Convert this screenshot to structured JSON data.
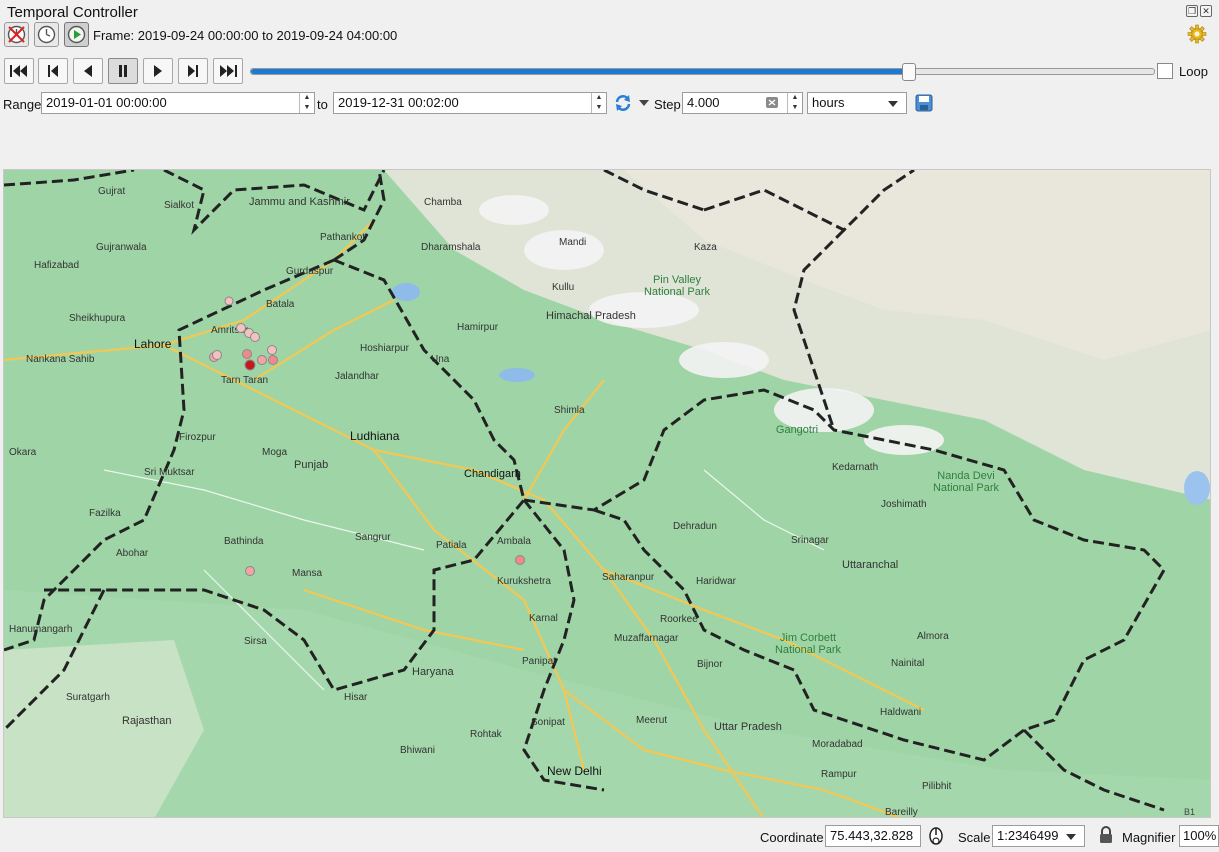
{
  "window": {
    "title": "Temporal Controller",
    "restore_symbol": "❐",
    "close_symbol": "✕"
  },
  "toolbar": {
    "mode_buttons": [
      {
        "name": "disable-temporal-navigation",
        "icon": "disabled-clock-icon"
      },
      {
        "name": "fixed-range-mode",
        "icon": "clock-icon"
      },
      {
        "name": "animated-mode",
        "icon": "play-circle-icon"
      }
    ],
    "frame_label": "Frame: 2019-09-24 00:00:00 to 2019-09-24 04:00:00",
    "settings_icon": "gear-icon"
  },
  "playback": {
    "buttons": [
      "rewind-to-start",
      "step-back",
      "play-backward",
      "pause",
      "play-forward",
      "step-forward",
      "fast-forward-to-end"
    ],
    "progress_fraction": 0.728,
    "loop_label": "Loop",
    "loop_checked": false,
    "accent": "#1f78d1"
  },
  "range": {
    "label": "Range",
    "start": "2019-01-01 00:00:00",
    "to_label": "to",
    "end": "2019-12-31 00:02:00",
    "step_label": "Step",
    "step_value": "4.000",
    "unit": "hours"
  },
  "map": {
    "regions": [
      "Jammu and Kashmir",
      "Himachal Pradesh",
      "Punjab",
      "Haryana",
      "Uttaranchal",
      "Uttar Pradesh",
      "Rajasthan"
    ],
    "cities": [
      "Gujrat",
      "Sialkot",
      "Gujranwala",
      "Hafizabad",
      "Sheikhupura",
      "Lahore",
      "Nankana Sahib",
      "Okara",
      "Pathankot",
      "Gurdaspur",
      "Batala",
      "Amritsar",
      "Tarn Taran Sahib",
      "Jalandhar",
      "Hoshiarpur",
      "Ludhiana",
      "Moga",
      "Firozpur",
      "Sri Muktsar Sahib",
      "Bathinda",
      "Mansa",
      "Sangrur",
      "Patiala",
      "Chandigarh",
      "Ambala",
      "Kurukshetra",
      "Karnal",
      "Panipat",
      "Sonipat",
      "Rohtak",
      "Hisar",
      "Sirsa",
      "Bhiwani",
      "New Delhi",
      "Meerut",
      "Muzaffarnagar",
      "Saharanpur",
      "Roorkee",
      "Haridwar",
      "Dehradun",
      "Shimla",
      "Kullu",
      "Mandi",
      "Dharamshala",
      "Chamba",
      "Una",
      "Hamirpur",
      "Kaza",
      "Kedarnath",
      "Joshimath",
      "Srinagar",
      "Almora",
      "Nainital",
      "Haldwani",
      "Moradabad",
      "Rampur",
      "Bareilly",
      "Pilibhit",
      "Bijnor",
      "Hanumangarh",
      "Suratgarh",
      "Abohar",
      "Fazilka"
    ],
    "parks": [
      "Pin Valley National Park",
      "Nanda Devi National Park",
      "Jim Corbett National Park",
      "Gangotri"
    ],
    "incident_color": "#f4a3a3",
    "incident_active_color": "#c8161d"
  },
  "status": {
    "coordinate_label": "Coordinate",
    "coordinate_value": "75.443,32.828",
    "scale_label": "Scale",
    "scale_value": "1:2346499",
    "magnifier_label": "Magnifier",
    "magnifier_value": "100%"
  }
}
